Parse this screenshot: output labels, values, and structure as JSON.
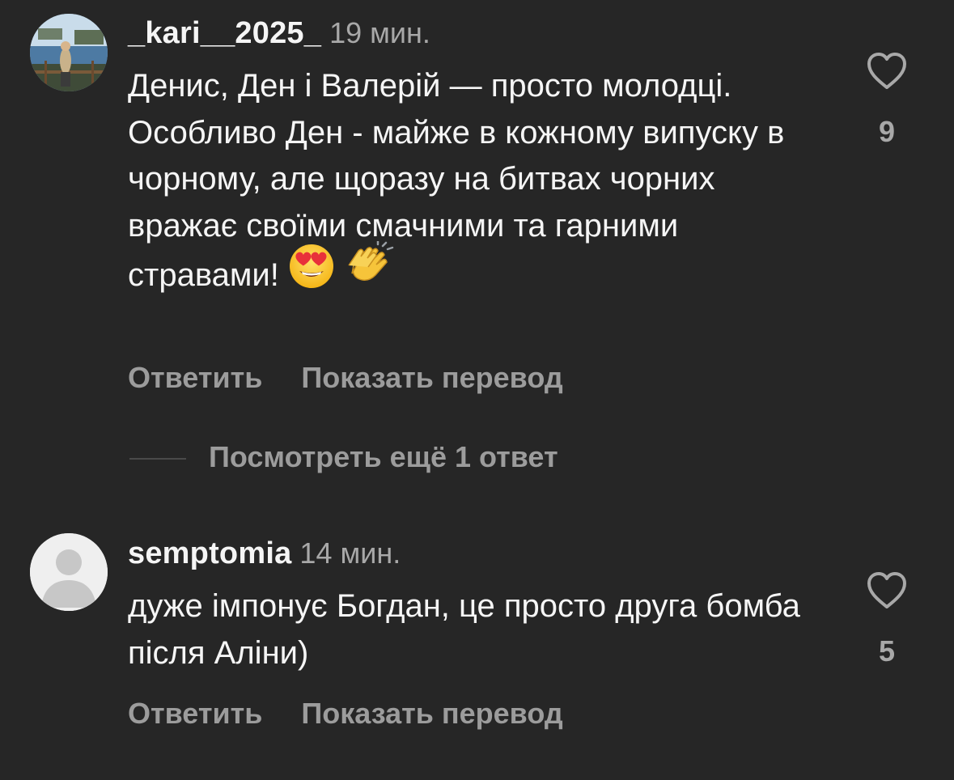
{
  "comments": [
    {
      "username": "_kari__2025_",
      "time": "19 мин.",
      "text": "Денис, Ден і Валерій — просто молодці. Особливо Ден - майже в кожному випуску в чорному, але щоразу на битвах чорних вражає своїми смачними та гарними стравами!",
      "emojis": [
        "heart-eyes-emoji",
        "clapping-hands-emoji"
      ],
      "like_count": "9",
      "reply_label": "Ответить",
      "translate_label": "Показать перевод"
    },
    {
      "username": "semptomia",
      "time": "14 мин.",
      "text": "дуже імпонує Богдан, це просто друга бомба після Аліни)",
      "like_count": "5",
      "reply_label": "Ответить",
      "translate_label": "Показать перевод"
    }
  ],
  "view_replies": "Посмотреть ещё 1 ответ",
  "colors": {
    "background": "#262626",
    "text": "#f5f5f5",
    "secondary": "#a8a8a8"
  }
}
